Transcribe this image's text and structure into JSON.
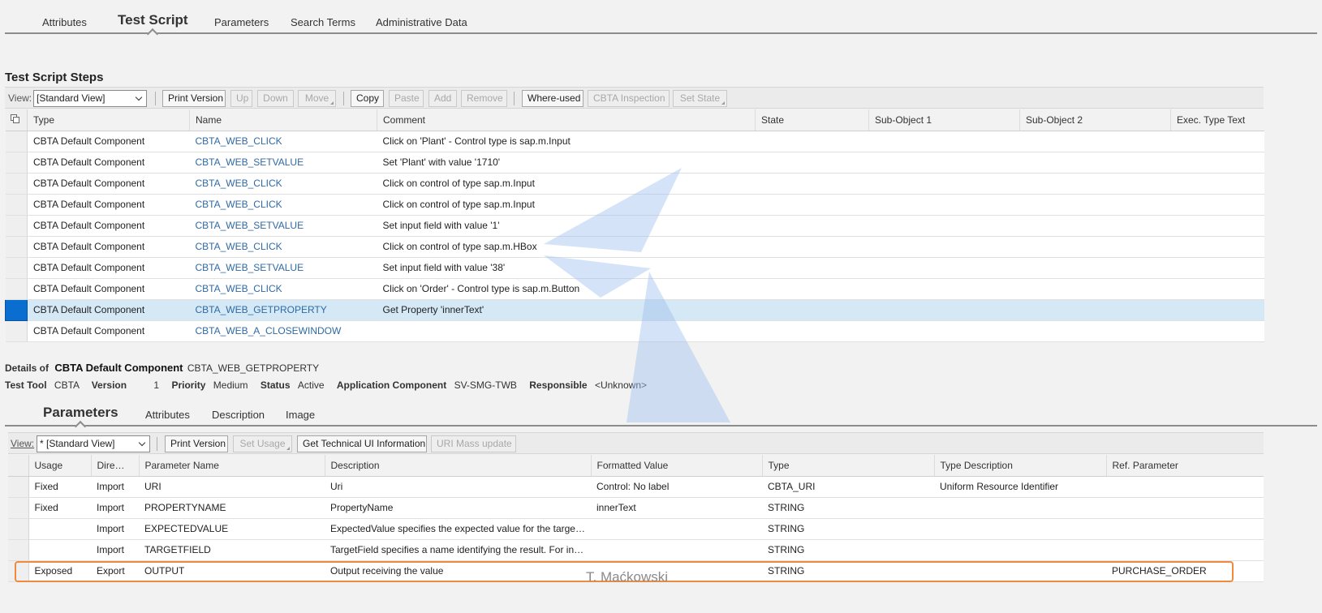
{
  "top_tabs": [
    {
      "label": "Attributes"
    },
    {
      "label": "Test Script",
      "active": true
    },
    {
      "label": "Parameters"
    },
    {
      "label": "Search Terms"
    },
    {
      "label": "Administrative Data"
    }
  ],
  "steps_section": {
    "title": "Test Script Steps",
    "toolbar": {
      "view_label": "View:",
      "view_value": "[Standard View]",
      "buttons": {
        "print_version": "Print Version",
        "up": "Up",
        "down": "Down",
        "move": "Move",
        "copy": "Copy",
        "paste": "Paste",
        "add": "Add",
        "remove": "Remove",
        "where_used": "Where-used",
        "cbta_inspection": "CBTA Inspection",
        "set_state": "Set State"
      }
    },
    "columns": [
      "Type",
      "Name",
      "Comment",
      "State",
      "Sub-Object 1",
      "Sub-Object 2",
      "Exec. Type Text"
    ],
    "rows": [
      {
        "type": "CBTA Default Component",
        "name": "CBTA_WEB_CLICK",
        "comment": "Click on 'Plant' - Control type is sap.m.Input"
      },
      {
        "type": "CBTA Default Component",
        "name": "CBTA_WEB_SETVALUE",
        "comment": "Set 'Plant' with value '1710'"
      },
      {
        "type": "CBTA Default Component",
        "name": "CBTA_WEB_CLICK",
        "comment": "Click on control of type sap.m.Input"
      },
      {
        "type": "CBTA Default Component",
        "name": "CBTA_WEB_CLICK",
        "comment": "Click on control of type sap.m.Input"
      },
      {
        "type": "CBTA Default Component",
        "name": "CBTA_WEB_SETVALUE",
        "comment": "Set input field with value '1'"
      },
      {
        "type": "CBTA Default Component",
        "name": "CBTA_WEB_CLICK",
        "comment": "Click on control of type sap.m.HBox"
      },
      {
        "type": "CBTA Default Component",
        "name": "CBTA_WEB_SETVALUE",
        "comment": "Set input field with value '38'"
      },
      {
        "type": "CBTA Default Component",
        "name": "CBTA_WEB_CLICK",
        "comment": "Click on 'Order' - Control type is sap.m.Button"
      },
      {
        "type": "CBTA Default Component",
        "name": "CBTA_WEB_GETPROPERTY",
        "comment": "Get Property 'innerText'",
        "selected": true
      },
      {
        "type": "CBTA Default Component",
        "name": "CBTA_WEB_A_CLOSEWINDOW",
        "comment": ""
      }
    ]
  },
  "details": {
    "prefix": "Details of",
    "component_type": "CBTA Default Component",
    "component_name": "CBTA_WEB_GETPROPERTY",
    "test_tool_label": "Test Tool",
    "test_tool_value": "CBTA",
    "version_label": "Version",
    "version_value": "1",
    "priority_label": "Priority",
    "priority_value": "Medium",
    "status_label": "Status",
    "status_value": "Active",
    "app_component_label": "Application Component",
    "app_component_value": "SV-SMG-TWB",
    "responsible_label": "Responsible",
    "responsible_value": "<Unknown>"
  },
  "detail_tabs": [
    {
      "label": "Parameters",
      "active": true
    },
    {
      "label": "Attributes"
    },
    {
      "label": "Description"
    },
    {
      "label": "Image"
    }
  ],
  "params_section": {
    "toolbar": {
      "view_label": "View:",
      "view_value": "* [Standard View]",
      "buttons": {
        "print_version": "Print Version",
        "set_usage": "Set Usage",
        "get_tech_ui": "Get Technical UI Information",
        "uri_mass_update": "URI Mass update"
      }
    },
    "columns": [
      "Usage",
      "Dire…",
      "Parameter Name",
      "Description",
      "Formatted Value",
      "Type",
      "Type Description",
      "Ref. Parameter"
    ],
    "rows": [
      {
        "usage": "Fixed",
        "dir": "Import",
        "name": "URI",
        "desc": "Uri",
        "value": "Control: No label",
        "type": "CBTA_URI",
        "type_desc": "Uniform Resource Identifier",
        "ref": ""
      },
      {
        "usage": "Fixed",
        "dir": "Import",
        "name": "PROPERTYNAME",
        "desc": "PropertyName",
        "value": "innerText",
        "type": "STRING",
        "type_desc": "",
        "ref": ""
      },
      {
        "usage": "",
        "dir": "Import",
        "name": "EXPECTEDVALUE",
        "desc": "ExpectedValue specifies the expected value for the target…",
        "value": "",
        "type": "STRING",
        "type_desc": "",
        "ref": ""
      },
      {
        "usage": "",
        "dir": "Import",
        "name": "TARGETFIELD",
        "desc": "TargetField specifies a name identifying the result. For ins…",
        "value": "",
        "type": "STRING",
        "type_desc": "",
        "ref": ""
      },
      {
        "usage": "Exposed",
        "dir": "Export",
        "name": "OUTPUT",
        "desc": "Output receiving the value",
        "value": "",
        "type": "STRING",
        "type_desc": "",
        "ref": "PURCHASE_ORDER"
      }
    ]
  },
  "signature": "T. Maćkowski",
  "colors": {
    "selected_row": "#d4e8f6",
    "selected_marker": "#0a6ed1",
    "link": "#2f6aa3",
    "highlight_border": "#f08a3c",
    "watermark": "#9fc2ee"
  }
}
